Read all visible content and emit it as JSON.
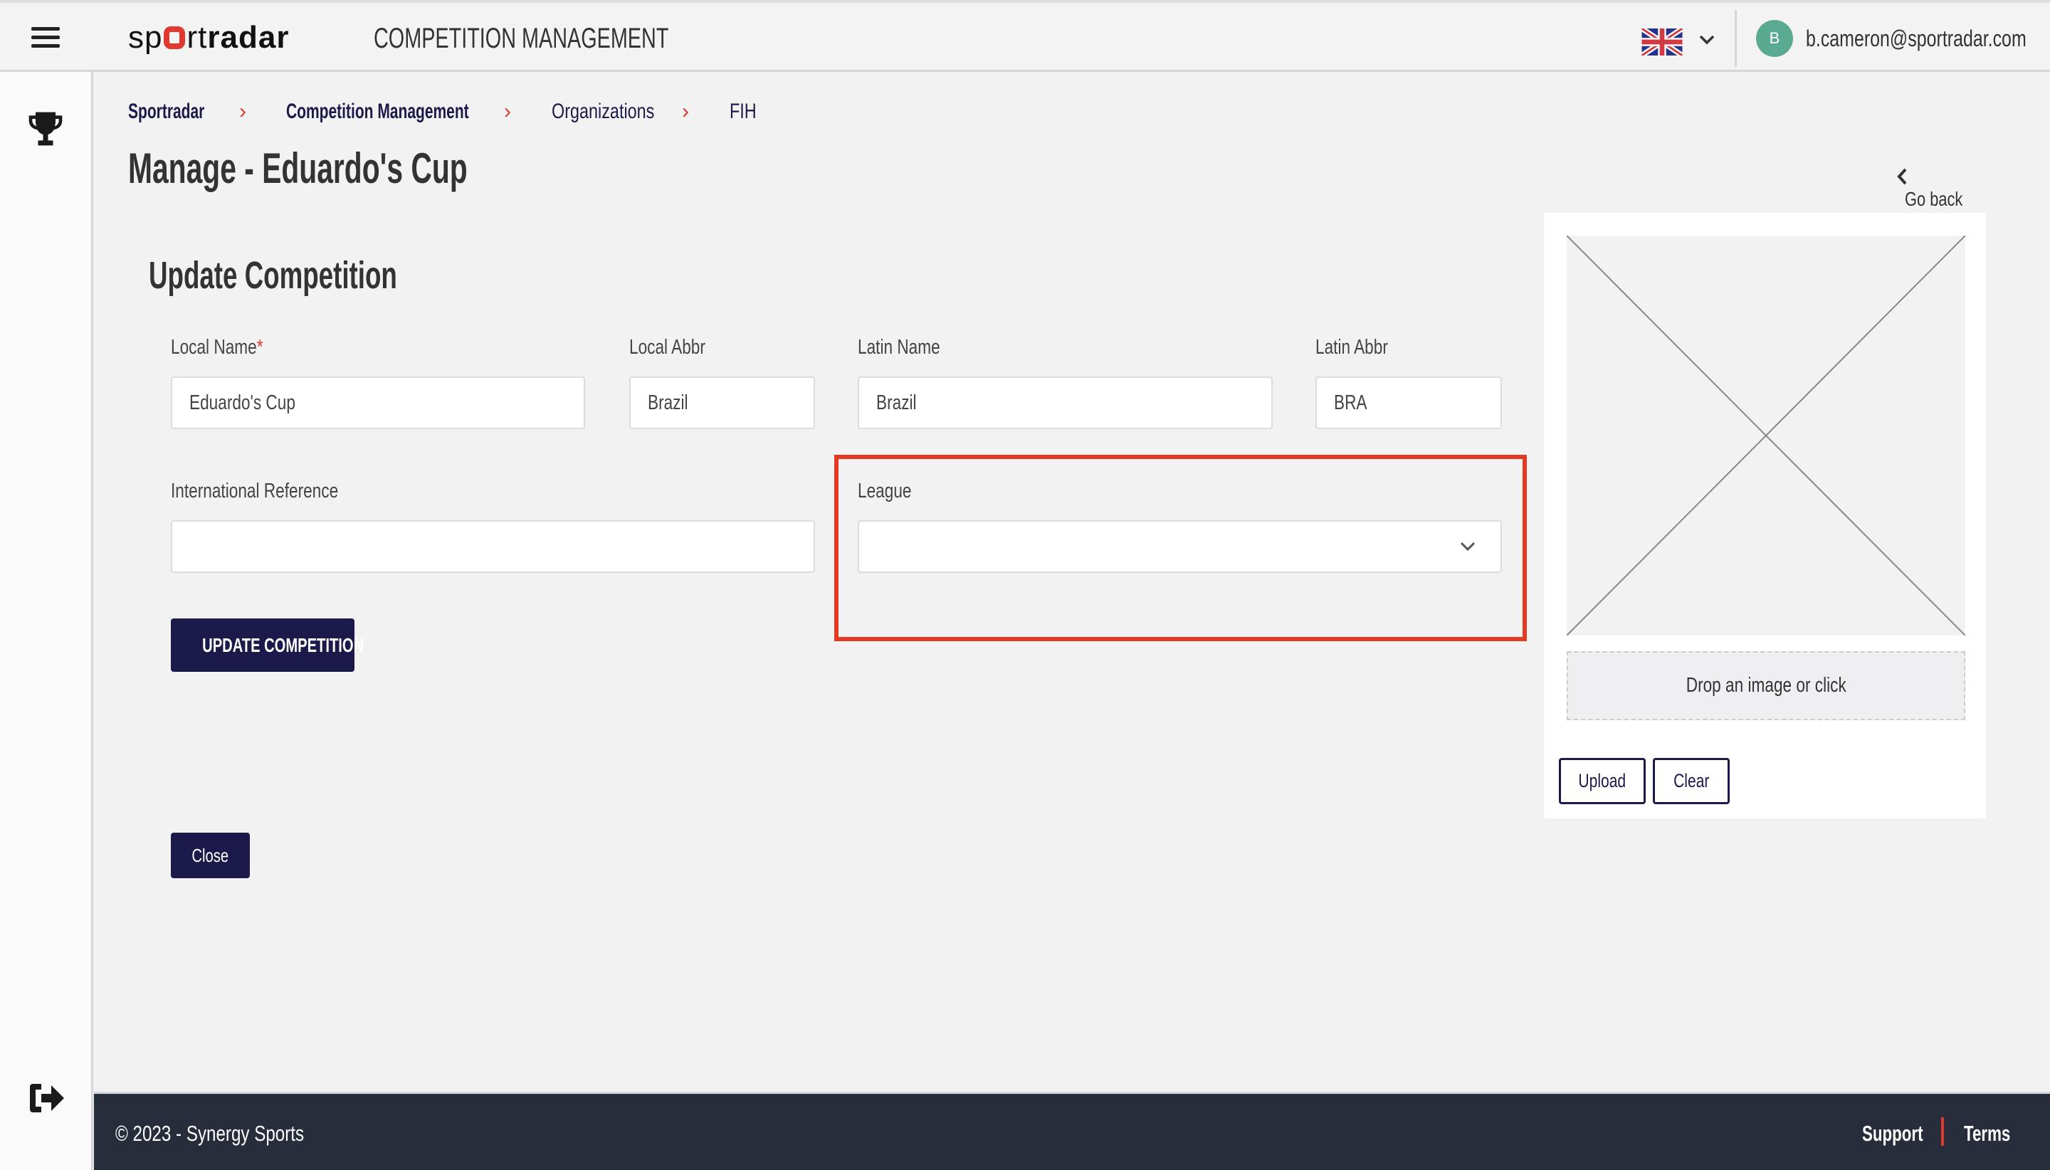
{
  "header": {
    "brand": "sportradar",
    "app_title": "COMPETITION MANAGEMENT",
    "language_icon": "uk-flag-icon",
    "avatar_initial": "B",
    "user_email": "b.cameron@sportradar.com"
  },
  "sidebar": {
    "items": [
      {
        "icon": "trophy-icon"
      }
    ],
    "logout_icon": "logout-icon"
  },
  "breadcrumb": [
    "Sportradar",
    "Competition Management",
    "Organizations",
    "FIH"
  ],
  "page_title": "Manage - Eduardo's Cup",
  "go_back": "Go back",
  "form": {
    "title": "Update Competition",
    "local_name": {
      "label": "Local Name",
      "required": "*",
      "value": "Eduardo's Cup"
    },
    "local_abbr": {
      "label": "Local Abbr",
      "value": "Brazil"
    },
    "latin_name": {
      "label": "Latin Name",
      "value": "Brazil"
    },
    "latin_abbr": {
      "label": "Latin Abbr",
      "value": "BRA"
    },
    "international_reference": {
      "label": "International Reference",
      "value": ""
    },
    "league": {
      "label": "League",
      "value": ""
    },
    "submit": "UPDATE COMPETITION",
    "close": "Close"
  },
  "image_panel": {
    "dropzone": "Drop an image or click",
    "upload": "Upload",
    "clear": "Clear"
  },
  "footer": {
    "copyright": "© 2023 - Synergy Sports",
    "support": "Support",
    "terms": "Terms"
  },
  "colors": {
    "primary": "#1c1a4b",
    "accent": "#e0392f",
    "footer": "#272d3a",
    "avatar": "#5aa991",
    "highlight": "#e33a24"
  }
}
